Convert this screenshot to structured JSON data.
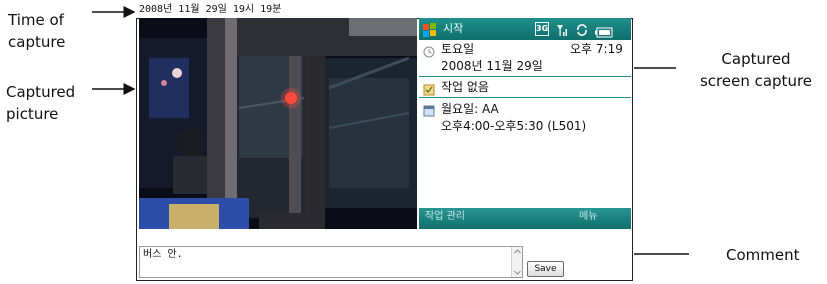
{
  "annotations": {
    "time_of_capture": [
      "Time of",
      "capture"
    ],
    "captured_picture": [
      "Captured",
      "picture"
    ],
    "captured_screen_capture": [
      "Captured",
      "screen capture"
    ],
    "comment": "Comment"
  },
  "app": {
    "timestamp": "2008년 11월 29일 19시 19분"
  },
  "phone_screen": {
    "status_bar": {
      "start_label": "시작",
      "network_badge": "3G"
    },
    "date_block": {
      "day_label": "토요일",
      "time_label": "오후 7:19",
      "date_label": "2008년 11월 29일"
    },
    "tasks_label": "작업 없음",
    "appointment": {
      "title": "월요일: AA",
      "time_range": "오후4:00-오후5:30 (L501)"
    },
    "softkeys": {
      "left": "작업 관리",
      "right": "메뉴"
    },
    "accent_color": "#1f8f8b"
  },
  "comment": {
    "value": "버스 안."
  },
  "save_button": {
    "label": "Save"
  }
}
